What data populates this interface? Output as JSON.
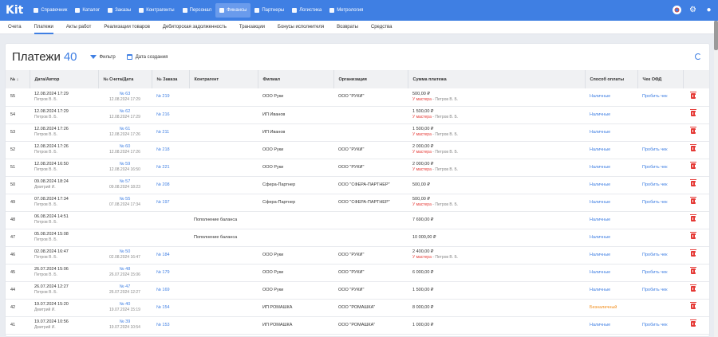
{
  "app": {
    "logo": "Kit"
  },
  "nav": [
    {
      "label": "Справочник",
      "icon": "book-icon",
      "active": false
    },
    {
      "label": "Каталог",
      "icon": "catalog-icon",
      "active": false
    },
    {
      "label": "Заказы",
      "icon": "orders-icon",
      "active": false
    },
    {
      "label": "Контрагенты",
      "icon": "contractors-icon",
      "active": false
    },
    {
      "label": "Персонал",
      "icon": "staff-icon",
      "active": false
    },
    {
      "label": "Финансы",
      "icon": "finance-icon",
      "active": true
    },
    {
      "label": "Партнеры",
      "icon": "partners-icon",
      "active": false
    },
    {
      "label": "Логистика",
      "icon": "truck-icon",
      "active": false
    },
    {
      "label": "Метрология",
      "icon": "metrology-icon",
      "active": false
    }
  ],
  "tabs": [
    {
      "label": "Счета",
      "active": false
    },
    {
      "label": "Платежи",
      "active": true
    },
    {
      "label": "Акты работ",
      "active": false
    },
    {
      "label": "Реализации товаров",
      "active": false
    },
    {
      "label": "Дебиторская задолженность",
      "active": false
    },
    {
      "label": "Транзакции",
      "active": false
    },
    {
      "label": "Бонусы исполнителя",
      "active": false
    },
    {
      "label": "Возвраты",
      "active": false
    },
    {
      "label": "Средства",
      "active": false
    }
  ],
  "page": {
    "title": "Платежи",
    "count": "40",
    "filter_label": "Фильтр",
    "date_filter_label": "Дата создания"
  },
  "columns": [
    "№ ↓",
    "Дата/Автор",
    "№ Счета/Дата",
    "№ Заказа",
    "Контрагент",
    "Филиал",
    "Организация",
    "Сумма платежа",
    "Способ оплаты",
    "Чек ОФД",
    ""
  ],
  "rows": [
    {
      "id": "55",
      "date": "12.08.2024 17:29",
      "author": "Петров В. Б.",
      "inv": "№ 63",
      "inv_date": "12.08.2024 17:29",
      "order": "№ 219",
      "contractor": "",
      "branch": "ООО Руки",
      "org": "ООО \"РУКИ\"",
      "sum": "500,00 ₽",
      "master_label": "У мастера",
      "master_name": " - Петров В. Б.",
      "pay": "Наличные",
      "pay_warn": false,
      "ofd": "Пробить чек"
    },
    {
      "id": "54",
      "date": "12.08.2024 17:29",
      "author": "Петров В. Б.",
      "inv": "№ 62",
      "inv_date": "12.08.2024 17:29",
      "order": "№ 216",
      "contractor": "",
      "branch": "ИП Иванов",
      "org": "",
      "sum": "1 500,00 ₽",
      "master_label": "У мастера",
      "master_name": " - Петров В. Б.",
      "pay": "Наличные",
      "pay_warn": false,
      "ofd": ""
    },
    {
      "id": "53",
      "date": "12.08.2024 17:26",
      "author": "Петров В. Б.",
      "inv": "№ 61",
      "inv_date": "12.08.2024 17:26",
      "order": "№ 211",
      "contractor": "",
      "branch": "ИП Иванов",
      "org": "",
      "sum": "1 500,00 ₽",
      "master_label": "У мастера",
      "master_name": " - Петров В. Б.",
      "pay": "Наличные",
      "pay_warn": false,
      "ofd": ""
    },
    {
      "id": "52",
      "date": "12.08.2024 17:26",
      "author": "Петров В. Б.",
      "inv": "№ 60",
      "inv_date": "12.08.2024 17:26",
      "order": "№ 218",
      "contractor": "",
      "branch": "ООО Руки",
      "org": "ООО \"РУКИ\"",
      "sum": "2 000,00 ₽",
      "master_label": "У мастера",
      "master_name": " - Петров В. Б.",
      "pay": "Наличные",
      "pay_warn": false,
      "ofd": "Пробить чек"
    },
    {
      "id": "51",
      "date": "12.08.2024 16:50",
      "author": "Петров В. Б.",
      "inv": "№ 59",
      "inv_date": "12.08.2024 16:50",
      "order": "№ 221",
      "contractor": "",
      "branch": "ООО Руки",
      "org": "ООО \"РУКИ\"",
      "sum": "2 000,00 ₽",
      "master_label": "У мастера",
      "master_name": " - Петров В. Б.",
      "pay": "Наличные",
      "pay_warn": false,
      "ofd": "Пробить чек"
    },
    {
      "id": "50",
      "date": "09.08.2024 18:24",
      "author": "Дмитрий И.",
      "inv": "№ 57",
      "inv_date": "09.08.2024 18:23",
      "order": "№ 208",
      "contractor": "",
      "branch": "Сфера-Партнер",
      "org": "ООО \"СФЕРА-ПАРТНЕР\"",
      "sum": "500,00 ₽",
      "master_label": "",
      "master_name": "",
      "pay": "Наличные",
      "pay_warn": false,
      "ofd": "Пробить чек"
    },
    {
      "id": "49",
      "date": "07.08.2024 17:34",
      "author": "Петров В. Б.",
      "inv": "№ 55",
      "inv_date": "07.08.2024 17:34",
      "order": "№ 197",
      "contractor": "",
      "branch": "Сфера-Партнер",
      "org": "ООО \"СФЕРА-ПАРТНЕР\"",
      "sum": "500,00 ₽",
      "master_label": "У мастера",
      "master_name": " - Петров В. Б.",
      "pay": "Наличные",
      "pay_warn": false,
      "ofd": "Пробить чек"
    },
    {
      "id": "48",
      "date": "06.08.2024 14:51",
      "author": "Петров В. Б.",
      "inv": "",
      "inv_date": "",
      "order": "",
      "contractor": "Пополнение баланса",
      "branch": "",
      "org": "",
      "sum": "7 690,00 ₽",
      "master_label": "",
      "master_name": "",
      "pay": "Наличные",
      "pay_warn": false,
      "ofd": ""
    },
    {
      "id": "47",
      "date": "05.08.2024 15:08",
      "author": "Петров В. Б.",
      "inv": "",
      "inv_date": "",
      "order": "",
      "contractor": "Пополнение баланса",
      "branch": "",
      "org": "",
      "sum": "10 000,00 ₽",
      "master_label": "",
      "master_name": "",
      "pay": "Наличные",
      "pay_warn": false,
      "ofd": ""
    },
    {
      "id": "46",
      "date": "02.08.2024 16:47",
      "author": "Петров В. Б.",
      "inv": "№ 50",
      "inv_date": "02.08.2024 16:47",
      "order": "№ 184",
      "contractor": "",
      "branch": "ООО Руки",
      "org": "ООО \"РУКИ\"",
      "sum": "2 400,00 ₽",
      "master_label": "У мастера",
      "master_name": " - Петров В. Б.",
      "pay": "Наличные",
      "pay_warn": false,
      "ofd": "Пробить чек"
    },
    {
      "id": "45",
      "date": "26.07.2024 15:06",
      "author": "Петров В. Б.",
      "inv": "№ 48",
      "inv_date": "26.07.2024 15:06",
      "order": "№ 179",
      "contractor": "",
      "branch": "ООО Руки",
      "org": "ООО \"РУКИ\"",
      "sum": "6 000,00 ₽",
      "master_label": "",
      "master_name": "",
      "pay": "Наличные",
      "pay_warn": false,
      "ofd": "Пробить чек"
    },
    {
      "id": "44",
      "date": "26.07.2024 12:27",
      "author": "Петров В. Б.",
      "inv": "№ 47",
      "inv_date": "26.07.2024 12:27",
      "order": "№ 169",
      "contractor": "",
      "branch": "ООО Руки",
      "org": "ООО \"РУКИ\"",
      "sum": "1 500,00 ₽",
      "master_label": "",
      "master_name": "",
      "pay": "Наличные",
      "pay_warn": false,
      "ofd": "Пробить чек"
    },
    {
      "id": "42",
      "date": "19.07.2024 15:20",
      "author": "Дмитрий И.",
      "inv": "№ 40",
      "inv_date": "19.07.2024 15:19",
      "order": "№ 154",
      "contractor": "",
      "branch": "ИП РОМАШКА",
      "org": "ООО \"РОМАШКА\"",
      "sum": "8 000,00 ₽",
      "master_label": "",
      "master_name": "",
      "pay": "Безналичный",
      "pay_warn": true,
      "ofd": ""
    },
    {
      "id": "41",
      "date": "19.07.2024 10:56",
      "author": "Дмитрий И.",
      "inv": "№ 39",
      "inv_date": "19.07.2024 10:54",
      "order": "№ 153",
      "contractor": "",
      "branch": "ИП РОМАШКА",
      "org": "ООО \"РОМАШКА\"",
      "sum": "1 000,00 ₽",
      "master_label": "",
      "master_name": "",
      "pay": "Наличные",
      "pay_warn": false,
      "ofd": "Пробить чек"
    }
  ]
}
